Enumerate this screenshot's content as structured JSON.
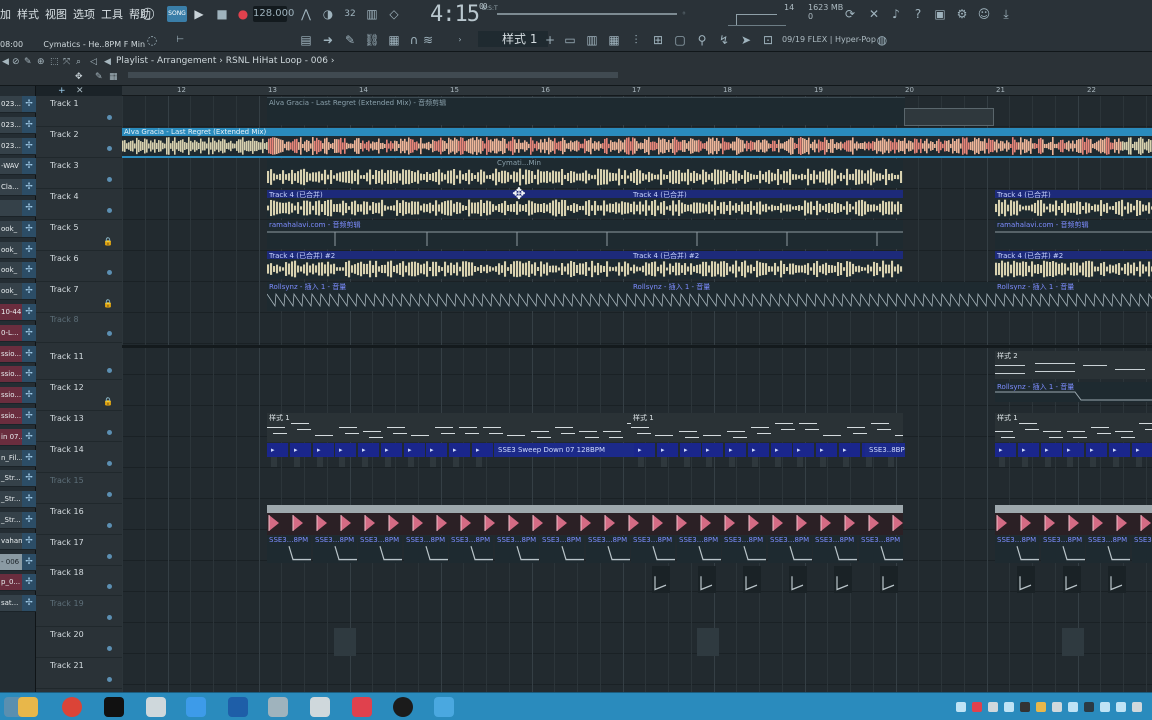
{
  "menu": [
    "加",
    "样式",
    "视图",
    "选项",
    "工具",
    "帮助"
  ],
  "transport": {
    "tempo": "128.000",
    "time_main": "4:15",
    "time_sub": "00",
    "time_tag": "B:S:T",
    "cpu": "14",
    "memory": "1623 MB",
    "memory_sub": "0"
  },
  "hint": {
    "time": "08:00",
    "text": "Cymatics - He..8PM F Min"
  },
  "pattern_selector": "样式 1",
  "mixer_info": "09/19  FLEX | Hyper-Pop",
  "playlist": {
    "title": "Playlist - Arrangement",
    "breadcrumb_sep": "›",
    "clip_name": "RSNL HiHat Loop - 006",
    "breadcrumb_end": "›"
  },
  "ruler_bars": [
    "12",
    "13",
    "14",
    "15",
    "16",
    "17",
    "18",
    "19",
    "20",
    "21",
    "22"
  ],
  "channels": [
    {
      "label": "023..."
    },
    {
      "label": "023..."
    },
    {
      "label": "023..."
    },
    {
      "label": "-WAV"
    },
    {
      "label": "Cla..."
    },
    {
      "label": ""
    },
    {
      "label": "ook_"
    },
    {
      "label": "ook_"
    },
    {
      "label": "ook_"
    },
    {
      "label": "ook_"
    },
    {
      "label": "10-44"
    },
    {
      "label": "0-L..."
    },
    {
      "label": "ssio..."
    },
    {
      "label": "ssio..."
    },
    {
      "label": "ssio..."
    },
    {
      "label": "ssio..."
    },
    {
      "label": "in 07..."
    },
    {
      "label": "n_Fil..."
    },
    {
      "label": "_Str..."
    },
    {
      "label": "_Str..."
    },
    {
      "label": "_Str..."
    },
    {
      "label": "vahan..."
    },
    {
      "label": "- 006"
    },
    {
      "label": "p_0..."
    },
    {
      "label": "sat..."
    }
  ],
  "tracks": [
    {
      "name": "Track 1",
      "dim": false,
      "lock": false
    },
    {
      "name": "Track 2",
      "dim": false,
      "lock": false
    },
    {
      "name": "Track 3",
      "dim": false,
      "lock": false
    },
    {
      "name": "Track 4",
      "dim": false,
      "lock": false
    },
    {
      "name": "Track 5",
      "dim": false,
      "lock": true
    },
    {
      "name": "Track 6",
      "dim": false,
      "lock": false
    },
    {
      "name": "Track 7",
      "dim": false,
      "lock": true
    },
    {
      "name": "Track 8",
      "dim": true,
      "lock": false
    },
    {
      "name": "Track 11",
      "dim": false,
      "lock": false
    },
    {
      "name": "Track 12",
      "dim": false,
      "lock": true
    },
    {
      "name": "Track 13",
      "dim": false,
      "lock": false
    },
    {
      "name": "Track 14",
      "dim": false,
      "lock": false
    },
    {
      "name": "Track 15",
      "dim": true,
      "lock": false
    },
    {
      "name": "Track 16",
      "dim": false,
      "lock": false
    },
    {
      "name": "Track 17",
      "dim": false,
      "lock": false
    },
    {
      "name": "Track 18",
      "dim": false,
      "lock": false
    },
    {
      "name": "Track 19",
      "dim": true,
      "lock": false
    },
    {
      "name": "Track 20",
      "dim": false,
      "lock": false
    },
    {
      "name": "Track 21",
      "dim": false,
      "lock": false
    }
  ],
  "clips": {
    "track1_label": "Alva Gracia - Last Regret (Extended Mix) - 音频剪辑",
    "track2_label": "Alva Gracia - Last Regret (Extended Mix)",
    "track3_label": "Cymati...Min",
    "track4_label": "Track 4 (已合并)",
    "track5_label": "ramahalavi.com - 音频剪辑",
    "track6_label": "Track 4 (已合并) #2",
    "track7_label": "Rollsynz - 插入 1 - 音量",
    "track11_label": "样式 2",
    "track12_label": "Rollsynz - 插入 1 - 音量",
    "track13_label": "样式 1",
    "track14_sweep": "SSE3 Sweep Down 07 128BPM",
    "track14_short": "SSE3..8BPM",
    "track17_label": "SSE3...8PM"
  },
  "colors": {
    "accent_blue": "#1d2a7a",
    "waveform_orange": "#f0b79a",
    "waveform_cream": "#d9d2b0",
    "pink_marker": "#d36b84",
    "taskbar": "#2a8bbd"
  }
}
